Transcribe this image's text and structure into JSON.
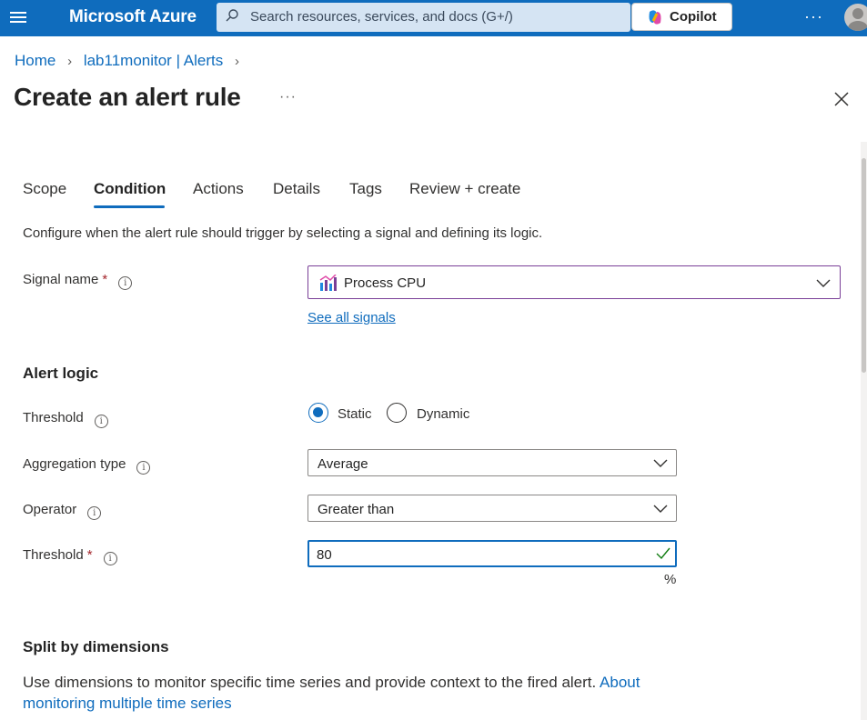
{
  "topbar": {
    "brand": "Microsoft Azure",
    "search_placeholder": "Search resources, services, and docs (G+/)",
    "copilot_label": "Copilot",
    "more": "···",
    "color": "#0f6cbd"
  },
  "breadcrumb": {
    "items": [
      "Home",
      "lab11monitor | Alerts"
    ]
  },
  "page": {
    "title": "Create an alert rule",
    "more": "···"
  },
  "tabs": [
    "Scope",
    "Condition",
    "Actions",
    "Details",
    "Tags",
    "Review + create"
  ],
  "active_tab": "Condition",
  "condition": {
    "description": "Configure when the alert rule should trigger by selecting a signal and defining its logic.",
    "signal_label": "Signal name",
    "signal_value": "Process CPU",
    "see_all_signals": "See all signals",
    "alert_logic_title": "Alert logic",
    "threshold_label": "Threshold",
    "threshold_options": [
      "Static",
      "Dynamic"
    ],
    "threshold_selected": "Static",
    "aggregation_label": "Aggregation type",
    "aggregation_value": "Average",
    "operator_label": "Operator",
    "operator_value": "Greater than",
    "threshold_value_label": "Threshold",
    "threshold_value": "80",
    "unit": "%",
    "split_title": "Split by dimensions",
    "split_text": "Use dimensions to monitor specific time series and provide context to the fired alert.",
    "split_link": "About monitoring multiple time series"
  },
  "icons": {
    "required": "*",
    "info": "i"
  }
}
